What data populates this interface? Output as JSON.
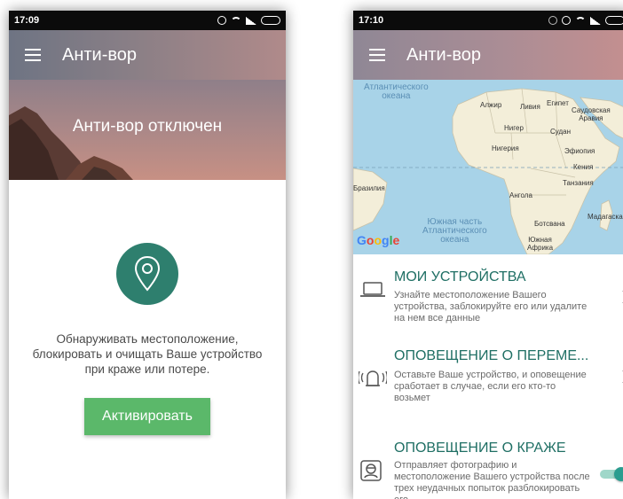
{
  "left_screen": {
    "status_time": "17:09",
    "app_title": "Анти-вор",
    "hero_text": "Анти-вор отключен",
    "description_lines": [
      "Обнаруживать местоположение,",
      "блокировать и очищать Ваше устройство",
      "при краже или потере."
    ],
    "activate_label": "Активировать",
    "accent_color": "#2e7f6e",
    "button_color": "#5bb86a"
  },
  "right_screen": {
    "status_time": "17:10",
    "app_title": "Анти-вор",
    "map_labels": {
      "atlantic_north": "Атлантического\nокеана",
      "algeria": "Алжир",
      "libya": "Ливия",
      "egypt": "Египет",
      "saudi": "Саудовская\nАравия",
      "niger": "Нигер",
      "sudan": "Судан",
      "nigeria": "Нигерия",
      "ethiopia": "Эфиопия",
      "kenya": "Кения",
      "tanzania": "Танзания",
      "brazil": "Бразилия",
      "angola": "Ангола",
      "madagascar": "Мадагаскар",
      "botswana": "Ботсвана",
      "south_atlantic": "Южная часть\nАтлантического\nокеана",
      "south_africa": "Южная\nАфрика",
      "google": "Google"
    },
    "items": [
      {
        "title": "МОИ УСТРОЙСТВА",
        "text": "Узнайте местоположение Вашего устройства, заблокируйте его или удалите на нем все данные",
        "icon": "laptop-icon"
      },
      {
        "title": "ОПОВЕЩЕНИЕ О ПЕРЕМЕ...",
        "text": "Оставьте Ваше устройство, и оповещение сработает в случае, если его кто-то возьмет",
        "icon": "alarm-icon"
      },
      {
        "title": "ОПОВЕЩЕНИЕ О КРАЖЕ",
        "text": "Отправляет фотографию и местоположение Вашего устройства после трех неудачных попыток разблокировать его",
        "icon": "thief-icon",
        "toggle_on": true
      }
    ],
    "accent_color": "#1f6f64"
  }
}
